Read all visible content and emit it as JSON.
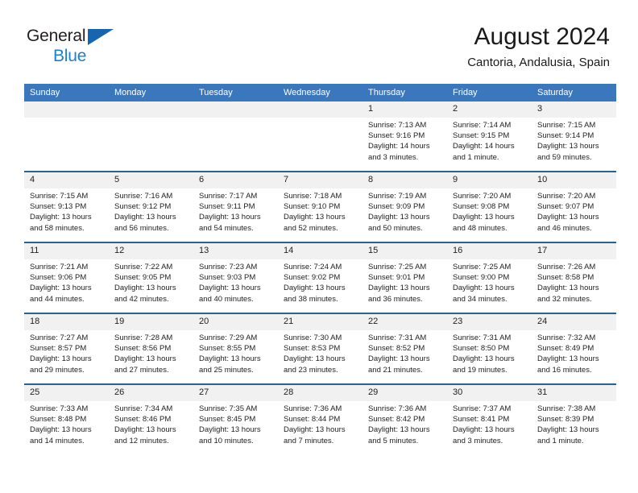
{
  "brand": {
    "line1": "General",
    "line2": "Blue",
    "logo_icon": "triangle-logo"
  },
  "header": {
    "title": "August 2024",
    "subtitle": "Cantoria, Andalusia, Spain"
  },
  "colors": {
    "header_bar": "#3a77bd",
    "row_divider": "#2c628f",
    "daynum_band": "#f1f1f1",
    "brand_blue": "#1b7fd4",
    "logo_blue": "#1565b0"
  },
  "weekdays": [
    "Sunday",
    "Monday",
    "Tuesday",
    "Wednesday",
    "Thursday",
    "Friday",
    "Saturday"
  ],
  "labels": {
    "sunrise": "Sunrise:",
    "sunset": "Sunset:",
    "daylight": "Daylight:"
  },
  "weeks": [
    [
      {
        "day": "",
        "empty": true
      },
      {
        "day": "",
        "empty": true
      },
      {
        "day": "",
        "empty": true
      },
      {
        "day": "",
        "empty": true
      },
      {
        "day": "1",
        "sunrise": "Sunrise: 7:13 AM",
        "sunset": "Sunset: 9:16 PM",
        "daylight1": "Daylight: 14 hours",
        "daylight2": "and 3 minutes."
      },
      {
        "day": "2",
        "sunrise": "Sunrise: 7:14 AM",
        "sunset": "Sunset: 9:15 PM",
        "daylight1": "Daylight: 14 hours",
        "daylight2": "and 1 minute."
      },
      {
        "day": "3",
        "sunrise": "Sunrise: 7:15 AM",
        "sunset": "Sunset: 9:14 PM",
        "daylight1": "Daylight: 13 hours",
        "daylight2": "and 59 minutes."
      }
    ],
    [
      {
        "day": "4",
        "sunrise": "Sunrise: 7:15 AM",
        "sunset": "Sunset: 9:13 PM",
        "daylight1": "Daylight: 13 hours",
        "daylight2": "and 58 minutes."
      },
      {
        "day": "5",
        "sunrise": "Sunrise: 7:16 AM",
        "sunset": "Sunset: 9:12 PM",
        "daylight1": "Daylight: 13 hours",
        "daylight2": "and 56 minutes."
      },
      {
        "day": "6",
        "sunrise": "Sunrise: 7:17 AM",
        "sunset": "Sunset: 9:11 PM",
        "daylight1": "Daylight: 13 hours",
        "daylight2": "and 54 minutes."
      },
      {
        "day": "7",
        "sunrise": "Sunrise: 7:18 AM",
        "sunset": "Sunset: 9:10 PM",
        "daylight1": "Daylight: 13 hours",
        "daylight2": "and 52 minutes."
      },
      {
        "day": "8",
        "sunrise": "Sunrise: 7:19 AM",
        "sunset": "Sunset: 9:09 PM",
        "daylight1": "Daylight: 13 hours",
        "daylight2": "and 50 minutes."
      },
      {
        "day": "9",
        "sunrise": "Sunrise: 7:20 AM",
        "sunset": "Sunset: 9:08 PM",
        "daylight1": "Daylight: 13 hours",
        "daylight2": "and 48 minutes."
      },
      {
        "day": "10",
        "sunrise": "Sunrise: 7:20 AM",
        "sunset": "Sunset: 9:07 PM",
        "daylight1": "Daylight: 13 hours",
        "daylight2": "and 46 minutes."
      }
    ],
    [
      {
        "day": "11",
        "sunrise": "Sunrise: 7:21 AM",
        "sunset": "Sunset: 9:06 PM",
        "daylight1": "Daylight: 13 hours",
        "daylight2": "and 44 minutes."
      },
      {
        "day": "12",
        "sunrise": "Sunrise: 7:22 AM",
        "sunset": "Sunset: 9:05 PM",
        "daylight1": "Daylight: 13 hours",
        "daylight2": "and 42 minutes."
      },
      {
        "day": "13",
        "sunrise": "Sunrise: 7:23 AM",
        "sunset": "Sunset: 9:03 PM",
        "daylight1": "Daylight: 13 hours",
        "daylight2": "and 40 minutes."
      },
      {
        "day": "14",
        "sunrise": "Sunrise: 7:24 AM",
        "sunset": "Sunset: 9:02 PM",
        "daylight1": "Daylight: 13 hours",
        "daylight2": "and 38 minutes."
      },
      {
        "day": "15",
        "sunrise": "Sunrise: 7:25 AM",
        "sunset": "Sunset: 9:01 PM",
        "daylight1": "Daylight: 13 hours",
        "daylight2": "and 36 minutes."
      },
      {
        "day": "16",
        "sunrise": "Sunrise: 7:25 AM",
        "sunset": "Sunset: 9:00 PM",
        "daylight1": "Daylight: 13 hours",
        "daylight2": "and 34 minutes."
      },
      {
        "day": "17",
        "sunrise": "Sunrise: 7:26 AM",
        "sunset": "Sunset: 8:58 PM",
        "daylight1": "Daylight: 13 hours",
        "daylight2": "and 32 minutes."
      }
    ],
    [
      {
        "day": "18",
        "sunrise": "Sunrise: 7:27 AM",
        "sunset": "Sunset: 8:57 PM",
        "daylight1": "Daylight: 13 hours",
        "daylight2": "and 29 minutes."
      },
      {
        "day": "19",
        "sunrise": "Sunrise: 7:28 AM",
        "sunset": "Sunset: 8:56 PM",
        "daylight1": "Daylight: 13 hours",
        "daylight2": "and 27 minutes."
      },
      {
        "day": "20",
        "sunrise": "Sunrise: 7:29 AM",
        "sunset": "Sunset: 8:55 PM",
        "daylight1": "Daylight: 13 hours",
        "daylight2": "and 25 minutes."
      },
      {
        "day": "21",
        "sunrise": "Sunrise: 7:30 AM",
        "sunset": "Sunset: 8:53 PM",
        "daylight1": "Daylight: 13 hours",
        "daylight2": "and 23 minutes."
      },
      {
        "day": "22",
        "sunrise": "Sunrise: 7:31 AM",
        "sunset": "Sunset: 8:52 PM",
        "daylight1": "Daylight: 13 hours",
        "daylight2": "and 21 minutes."
      },
      {
        "day": "23",
        "sunrise": "Sunrise: 7:31 AM",
        "sunset": "Sunset: 8:50 PM",
        "daylight1": "Daylight: 13 hours",
        "daylight2": "and 19 minutes."
      },
      {
        "day": "24",
        "sunrise": "Sunrise: 7:32 AM",
        "sunset": "Sunset: 8:49 PM",
        "daylight1": "Daylight: 13 hours",
        "daylight2": "and 16 minutes."
      }
    ],
    [
      {
        "day": "25",
        "sunrise": "Sunrise: 7:33 AM",
        "sunset": "Sunset: 8:48 PM",
        "daylight1": "Daylight: 13 hours",
        "daylight2": "and 14 minutes."
      },
      {
        "day": "26",
        "sunrise": "Sunrise: 7:34 AM",
        "sunset": "Sunset: 8:46 PM",
        "daylight1": "Daylight: 13 hours",
        "daylight2": "and 12 minutes."
      },
      {
        "day": "27",
        "sunrise": "Sunrise: 7:35 AM",
        "sunset": "Sunset: 8:45 PM",
        "daylight1": "Daylight: 13 hours",
        "daylight2": "and 10 minutes."
      },
      {
        "day": "28",
        "sunrise": "Sunrise: 7:36 AM",
        "sunset": "Sunset: 8:44 PM",
        "daylight1": "Daylight: 13 hours",
        "daylight2": "and 7 minutes."
      },
      {
        "day": "29",
        "sunrise": "Sunrise: 7:36 AM",
        "sunset": "Sunset: 8:42 PM",
        "daylight1": "Daylight: 13 hours",
        "daylight2": "and 5 minutes."
      },
      {
        "day": "30",
        "sunrise": "Sunrise: 7:37 AM",
        "sunset": "Sunset: 8:41 PM",
        "daylight1": "Daylight: 13 hours",
        "daylight2": "and 3 minutes."
      },
      {
        "day": "31",
        "sunrise": "Sunrise: 7:38 AM",
        "sunset": "Sunset: 8:39 PM",
        "daylight1": "Daylight: 13 hours",
        "daylight2": "and 1 minute."
      }
    ]
  ]
}
